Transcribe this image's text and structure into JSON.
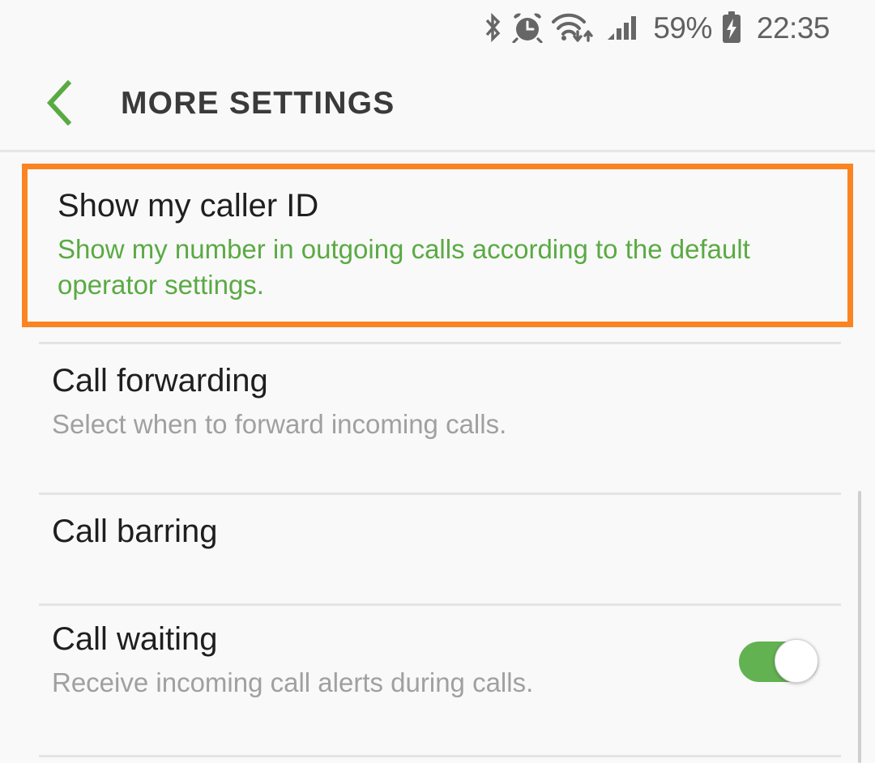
{
  "status_bar": {
    "icons": [
      "bluetooth-icon",
      "alarm-icon",
      "wifi-icon",
      "signal-icon",
      "battery-charging-icon"
    ],
    "battery_percent": "59%",
    "clock": "22:35",
    "icon_color": "#666666"
  },
  "header": {
    "back_icon": "back-chevron-icon",
    "title": "MORE SETTINGS",
    "accent_color": "#5aaa43"
  },
  "highlight": {
    "border_color": "#fb8422"
  },
  "settings": {
    "items": [
      {
        "title": "Show my caller ID",
        "subtitle": "Show my number in outgoing calls according to the default operator settings.",
        "subtitle_color": "#5aaa43",
        "highlighted": true,
        "has_toggle": false
      },
      {
        "title": "Call forwarding",
        "subtitle": "Select when to forward incoming calls.",
        "subtitle_color": "#a0a0a0",
        "highlighted": false,
        "has_toggle": false
      },
      {
        "title": "Call barring",
        "subtitle": "",
        "subtitle_color": "#a0a0a0",
        "highlighted": false,
        "has_toggle": false
      },
      {
        "title": "Call waiting",
        "subtitle": "Receive incoming call alerts during calls.",
        "subtitle_color": "#a0a0a0",
        "highlighted": false,
        "has_toggle": true,
        "toggle_state": "on",
        "toggle_color": "#62b252"
      }
    ]
  }
}
